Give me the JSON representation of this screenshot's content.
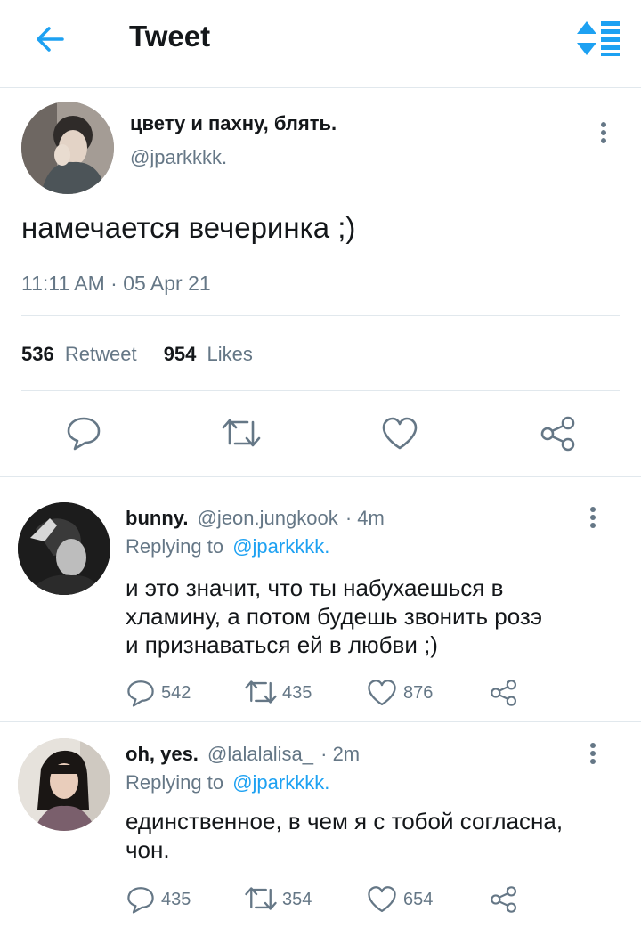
{
  "header": {
    "title": "Tweet"
  },
  "main_tweet": {
    "display_name": "цвету и пахну, блять.",
    "handle": "@jparkkkk.",
    "text": "намечается вечеринка ;)",
    "timestamp": "11:11 AM · 05 Apr 21",
    "retweet_count": "536",
    "retweet_label": "Retweet",
    "likes_count": "954",
    "likes_label": "Likes"
  },
  "replies": [
    {
      "display_name": "bunny.",
      "handle": "@jeon.jungkook",
      "time": "· 4m",
      "replying_prefix": "Replying to",
      "replying_handle": "@jparkkkk.",
      "text_lines": [
        "и это значит, что ты набухаешься в",
        "хламину, а потом будешь звонить розэ",
        "и признаваться ей в любви ;)"
      ],
      "reply_count": "542",
      "retweet_count": "435",
      "like_count": "876"
    },
    {
      "display_name": "oh, yes.",
      "handle": "@lalalalisa_",
      "time": "· 2m",
      "replying_prefix": "Replying to",
      "replying_handle": "@jparkkkk.",
      "text_lines": [
        "единственное, в чем я с тобой согласна,",
        "чон."
      ],
      "reply_count": "435",
      "retweet_count": "354",
      "like_count": "654"
    }
  ],
  "icons": {
    "back": "arrow-left-icon",
    "sort": "sort-list-icon",
    "more": "more-vertical-icon",
    "reply": "comment-icon",
    "retweet": "retweet-icon",
    "like": "heart-icon",
    "share": "share-icon"
  },
  "colors": {
    "accent": "#1da1f2",
    "muted": "#657786",
    "divider": "#e1e8ed"
  }
}
